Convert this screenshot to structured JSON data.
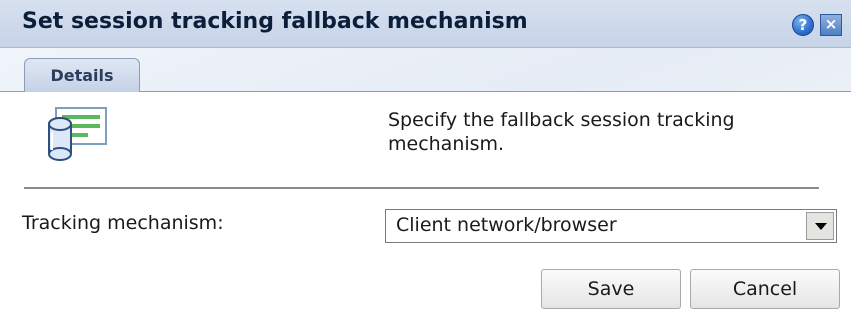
{
  "dialog": {
    "title": "Set session tracking fallback mechanism",
    "help_icon": "help-icon",
    "help_glyph": "?",
    "close_icon": "close-icon",
    "close_glyph": "×"
  },
  "tabs": [
    {
      "label": "Details",
      "active": true
    }
  ],
  "content": {
    "icon": "form-icon",
    "description": "Specify the fallback session tracking mechanism."
  },
  "form": {
    "tracking_label": "Tracking mechanism:",
    "tracking_value": "Client network/browser"
  },
  "buttons": {
    "save_label": "Save",
    "cancel_label": "Cancel"
  },
  "colors": {
    "title_text": "#0d1e3a",
    "titlebar_bg": "#c7d4e8",
    "help_blue": "#2f6fcf"
  }
}
